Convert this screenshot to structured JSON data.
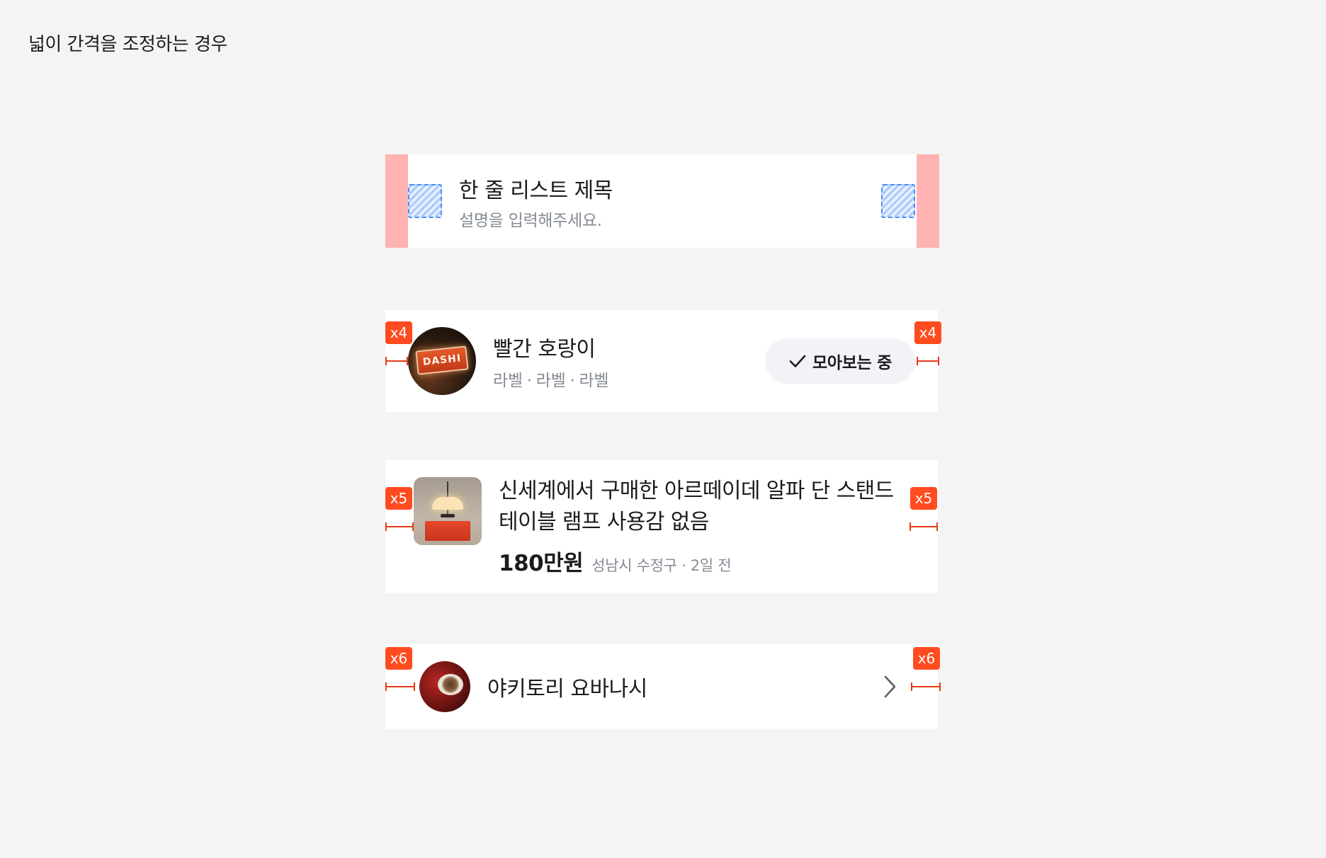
{
  "page_title": "넓이 간격을 조정하는 경우",
  "colors": {
    "page_background": "#f4f4f4",
    "card_background": "#ffffff",
    "padding_highlight": "#ffb3b3",
    "slot_outline": "#4a8ef0",
    "marker": "#ff4b1f",
    "muted_text": "#868b94"
  },
  "card1": {
    "title": "한 줄 리스트 제목",
    "description": "설명을 입력해주세요."
  },
  "card2": {
    "badge_left": "x4",
    "badge_right": "x4",
    "avatar_sign_text": "DASHI",
    "title": "빨간 호랑이",
    "labels": [
      "라벨",
      "라벨",
      "라벨"
    ],
    "label_separator": "·",
    "button_icon": "check-icon",
    "button_label": "모아보는 중"
  },
  "card3": {
    "badge_left": "x5",
    "badge_right": "x5",
    "title": "신세계에서 구매한 아르떼이데 알파 단 스탠드 테이블 램프 사용감 없음",
    "price": "180만원",
    "location_time": "성남시 수정구 · 2일 전"
  },
  "card4": {
    "badge_left": "x6",
    "badge_right": "x6",
    "title": "야키토리 요바나시",
    "trailing_icon": "chevron-right-icon"
  }
}
